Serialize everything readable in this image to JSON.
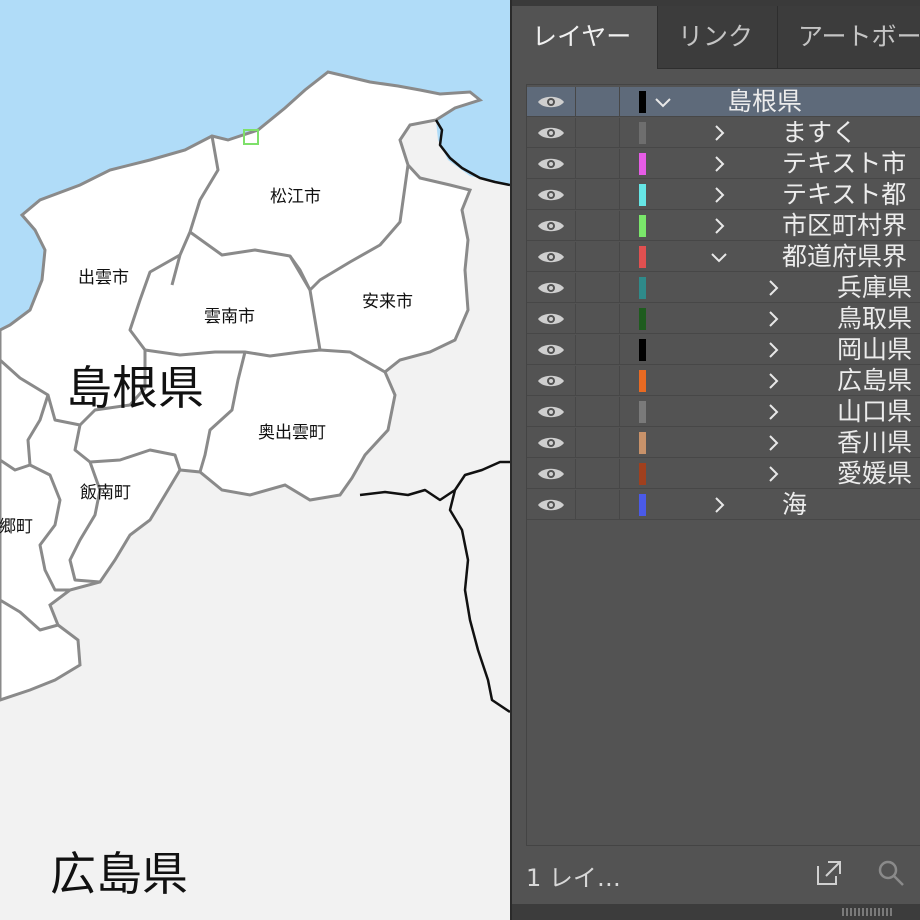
{
  "map": {
    "colors": {
      "sea": "#b0dcf8",
      "land": "#ffffff",
      "other_land": "#f2f2f2",
      "border": "#8a8a8a",
      "pref_border": "#111111",
      "selection": "#7ee06a"
    },
    "prefecture_labels": {
      "shimane": "島根県",
      "hiroshima": "広島県"
    },
    "city_labels": {
      "matsue": "松江市",
      "izumo": "出雲市",
      "unnan": "雲南市",
      "yasugi": "安来市",
      "okuizumo": "奥出雲町",
      "iinan": "飯南町",
      "misato": "美郷町"
    }
  },
  "panel": {
    "tabs": {
      "layers": "レイヤー",
      "links": "リンク",
      "artboards": "アートボー"
    },
    "layers": [
      {
        "name": "島根県",
        "color": "#000000",
        "expanded": true,
        "selected": true,
        "depth": 0
      },
      {
        "name": "ますく",
        "color": "#6e6e6e",
        "expanded": false,
        "selected": false,
        "depth": 1
      },
      {
        "name": "テキスト市",
        "color": "#e65ce6",
        "expanded": false,
        "selected": false,
        "depth": 1
      },
      {
        "name": "テキスト都",
        "color": "#66e6e6",
        "expanded": false,
        "selected": false,
        "depth": 1
      },
      {
        "name": "市区町村界",
        "color": "#7ae66a",
        "expanded": false,
        "selected": false,
        "depth": 1
      },
      {
        "name": "都道府県界",
        "color": "#e05050",
        "expanded": true,
        "selected": false,
        "depth": 1
      },
      {
        "name": "兵庫県",
        "color": "#2f8a8a",
        "expanded": false,
        "selected": false,
        "depth": 2
      },
      {
        "name": "鳥取県",
        "color": "#1e5c1e",
        "expanded": false,
        "selected": false,
        "depth": 2
      },
      {
        "name": "岡山県",
        "color": "#000000",
        "expanded": false,
        "selected": false,
        "depth": 2
      },
      {
        "name": "広島県",
        "color": "#e86a22",
        "expanded": false,
        "selected": false,
        "depth": 2
      },
      {
        "name": "山口県",
        "color": "#7a7a7a",
        "expanded": false,
        "selected": false,
        "depth": 2
      },
      {
        "name": "香川県",
        "color": "#c8926a",
        "expanded": false,
        "selected": false,
        "depth": 2
      },
      {
        "name": "愛媛県",
        "color": "#a0401e",
        "expanded": false,
        "selected": false,
        "depth": 2
      },
      {
        "name": "海",
        "color": "#4a5ae8",
        "expanded": false,
        "selected": false,
        "depth": 1
      }
    ],
    "footer": {
      "count_text": "1 レイ…"
    }
  }
}
